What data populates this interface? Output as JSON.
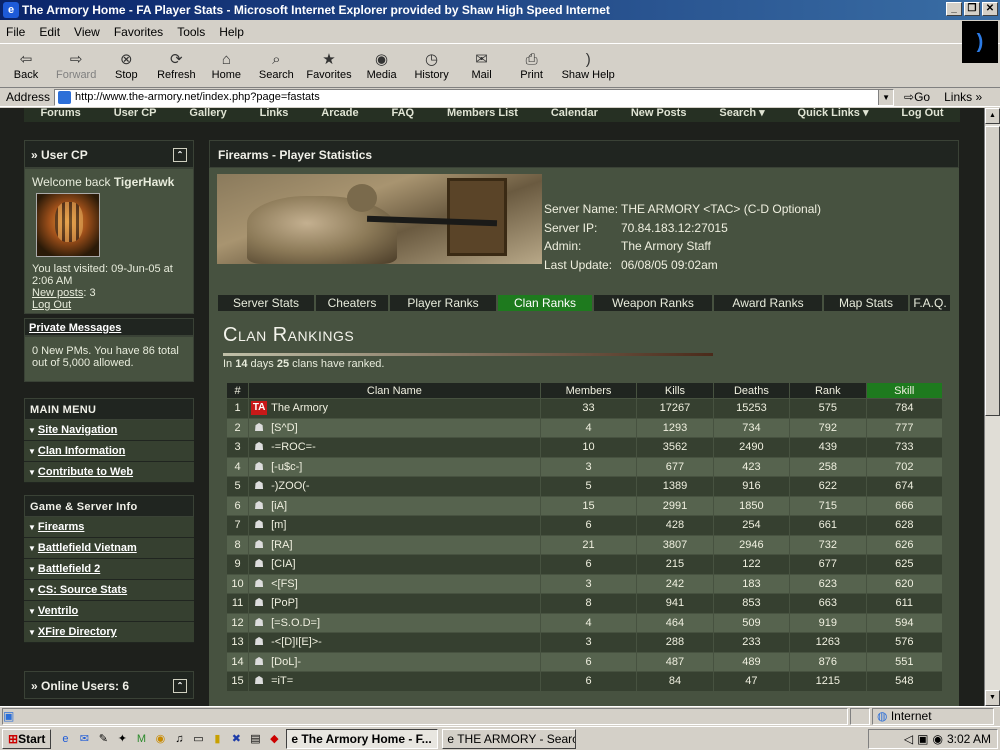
{
  "window": {
    "title": "The Armory Home - FA Player Stats - Microsoft Internet Explorer provided by Shaw High Speed Internet"
  },
  "menu": [
    "File",
    "Edit",
    "View",
    "Favorites",
    "Tools",
    "Help"
  ],
  "toolbar": [
    {
      "label": "Back",
      "icon": "back-arrow-icon"
    },
    {
      "label": "Forward",
      "icon": "forward-arrow-icon",
      "disabled": true
    },
    {
      "label": "Stop",
      "icon": "stop-icon"
    },
    {
      "label": "Refresh",
      "icon": "refresh-icon"
    },
    {
      "label": "Home",
      "icon": "home-icon"
    },
    {
      "label": "Search",
      "icon": "search-icon"
    },
    {
      "label": "Favorites",
      "icon": "favorites-icon"
    },
    {
      "label": "Media",
      "icon": "media-icon"
    },
    {
      "label": "History",
      "icon": "history-icon"
    },
    {
      "label": "Mail",
      "icon": "mail-icon"
    },
    {
      "label": "Print",
      "icon": "print-icon"
    },
    {
      "label": "Shaw Help",
      "icon": "help-icon"
    }
  ],
  "address": {
    "label": "Address",
    "url": "http://www.the-armory.net/index.php?page=fastats",
    "go": "Go",
    "links": "Links"
  },
  "sitenav": [
    "Forums",
    "User CP",
    "Gallery",
    "Links",
    "Arcade",
    "FAQ",
    "Members List",
    "Calendar",
    "New Posts",
    "Search ▾",
    "Quick Links ▾",
    "Log Out"
  ],
  "usercp": {
    "title": "» User CP",
    "welcome": "Welcome back ",
    "user": "TigerHawk",
    "visited": "You last visited: 09-Jun-05 at 2:06 AM",
    "newposts_label": "New posts",
    "newposts_count": ": 3",
    "logout": "Log Out"
  },
  "pm": {
    "title": "Private Messages",
    "text": "0 New PMs. You have 86 total out of 5,000 allowed."
  },
  "mainmenu": {
    "title": "MAIN MENU",
    "items": [
      "Site Navigation",
      "Clan Information",
      "Contribute to Web"
    ]
  },
  "gamemenu": {
    "title": "Game & Server Info",
    "items": [
      "Firearms",
      "Battlefield Vietnam",
      "Battlefield 2",
      "CS: Source Stats",
      "Ventrilo",
      "XFire Directory"
    ]
  },
  "online": {
    "title": "» Online Users: 6"
  },
  "main": {
    "header": "Firearms - Player Statistics"
  },
  "server": [
    {
      "k": "Server Name:",
      "v": "THE ARMORY <TAC> (C-D Optional)"
    },
    {
      "k": "Server IP:",
      "v": "70.84.183.12:27015"
    },
    {
      "k": "Admin:",
      "v": "The Armory Staff"
    },
    {
      "k": "Last Update:",
      "v": "06/08/05 09:02am"
    }
  ],
  "tabs": [
    {
      "label": "Server Stats",
      "w": 98
    },
    {
      "label": "Cheaters",
      "w": 74
    },
    {
      "label": "Player Ranks",
      "w": 108
    },
    {
      "label": "Clan Ranks",
      "w": 96,
      "active": true
    },
    {
      "label": "Weapon Ranks",
      "w": 120
    },
    {
      "label": "Award Ranks",
      "w": 110
    },
    {
      "label": "Map Stats",
      "w": 86
    },
    {
      "label": "F.A.Q.",
      "w": 42
    }
  ],
  "clan": {
    "title": "Clan Rankings",
    "sub_pre": "In ",
    "days": "14",
    "sub_mid": " days ",
    "clans": "25",
    "sub_post": " clans have ranked.",
    "headers": [
      "#",
      "Clan Name",
      "Members",
      "Kills",
      "Deaths",
      "Rank",
      "Skill"
    ],
    "rows": [
      [
        "1",
        "The Armory",
        "33",
        "17267",
        "15253",
        "575",
        "784"
      ],
      [
        "2",
        "[S^D]",
        "4",
        "1293",
        "734",
        "792",
        "777"
      ],
      [
        "3",
        "-=ROC=-",
        "10",
        "3562",
        "2490",
        "439",
        "733"
      ],
      [
        "4",
        "[-u$c-]",
        "3",
        "677",
        "423",
        "258",
        "702"
      ],
      [
        "5",
        "-)ZOO(-",
        "5",
        "1389",
        "916",
        "622",
        "674"
      ],
      [
        "6",
        "[iA]",
        "15",
        "2991",
        "1850",
        "715",
        "666"
      ],
      [
        "7",
        "[m]",
        "6",
        "428",
        "254",
        "661",
        "628"
      ],
      [
        "8",
        "[RA]",
        "21",
        "3807",
        "2946",
        "732",
        "626"
      ],
      [
        "9",
        "[CIA]",
        "6",
        "215",
        "122",
        "677",
        "625"
      ],
      [
        "10",
        "<[FS]",
        "3",
        "242",
        "183",
        "623",
        "620"
      ],
      [
        "11",
        "[PoP]",
        "8",
        "941",
        "853",
        "663",
        "611"
      ],
      [
        "12",
        "[=S.O.D=]",
        "4",
        "464",
        "509",
        "919",
        "594"
      ],
      [
        "13",
        "-<[D]I[E]>-",
        "3",
        "288",
        "233",
        "1263",
        "576"
      ],
      [
        "14",
        "[DoL]-",
        "6",
        "487",
        "489",
        "876",
        "551"
      ],
      [
        "15",
        "=iT=",
        "6",
        "84",
        "47",
        "1215",
        "548"
      ]
    ]
  },
  "status": {
    "zone": "Internet"
  },
  "taskbar": {
    "start": "Start",
    "tasks": [
      "The Armory Home - F...",
      "THE ARMORY - Search R..."
    ],
    "clock": "3:02 AM"
  }
}
